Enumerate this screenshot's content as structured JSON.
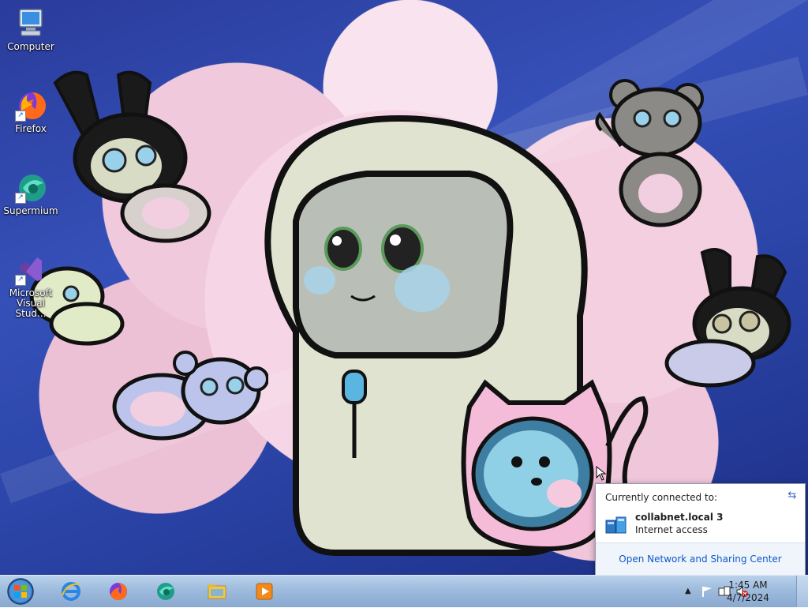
{
  "desktop": {
    "icons": [
      {
        "label": "Computer",
        "icon": "computer-icon"
      },
      {
        "label": "Firefox",
        "icon": "firefox-icon"
      },
      {
        "label": "Supermium",
        "icon": "supermium-icon"
      },
      {
        "label": "Microsoft Visual Stud...",
        "icon": "visual-studio-icon"
      }
    ]
  },
  "network_flyout": {
    "header": "Currently connected to:",
    "network_name": "collabnet.local  3",
    "network_status": "Internet access",
    "footer_link": "Open Network and Sharing Center"
  },
  "taskbar": {
    "pinned": [
      {
        "name": "internet-explorer",
        "icon": "ie-icon"
      },
      {
        "name": "firefox",
        "icon": "firefox-icon"
      },
      {
        "name": "supermium",
        "icon": "supermium-icon"
      },
      {
        "name": "file-explorer",
        "icon": "folder-icon"
      },
      {
        "name": "media-player",
        "icon": "media-player-icon"
      }
    ],
    "clock": {
      "time": "1:45 AM",
      "date": "4/7/2024"
    }
  },
  "colors": {
    "taskbar": "#9bb9dc",
    "link": "#0b58c8",
    "wallpaper_blue": "#2b45a8",
    "wallpaper_pink": "#f3cfe0"
  }
}
